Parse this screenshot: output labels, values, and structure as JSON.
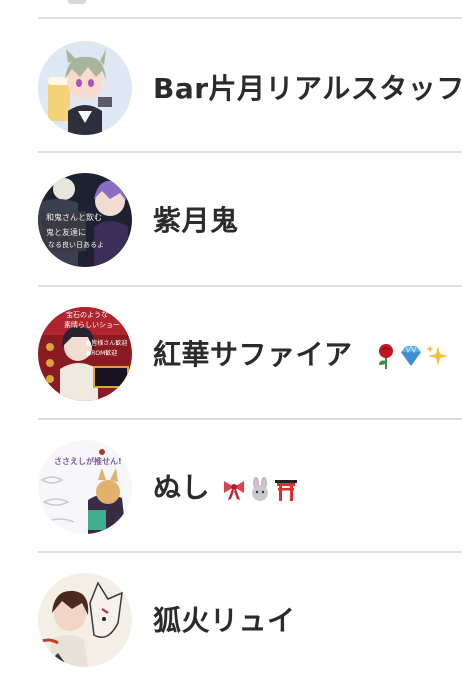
{
  "users": [
    {
      "name": "Bar片月リアルスタッフ",
      "avatar_icon": "avatar-bar-kataduki"
    },
    {
      "name": "紫月鬼",
      "avatar_icon": "avatar-shizuki"
    },
    {
      "name": "紅華サファイア",
      "avatar_icon": "avatar-kouka",
      "emojis": [
        "rose-emoji",
        "gem-emoji",
        "sparkles-emoji"
      ]
    },
    {
      "name": "ぬし",
      "avatar_icon": "avatar-nushi",
      "emojis": [
        "ribbon-emoji",
        "rabbit-emoji",
        "torii-emoji"
      ]
    },
    {
      "name": "狐火リュイ",
      "avatar_icon": "avatar-kitsunebi"
    }
  ],
  "avatar_texts": {
    "shizuki_line1": "和鬼さんと飲む",
    "shizuki_line2": "鬼と友達に",
    "shizuki_line3": "なる良い日あるよ",
    "kouka_line1": "宝石のような",
    "kouka_line2": "素晴らしいショー",
    "kouka_line3": "●皆様さん歓迎",
    "kouka_line4": "●ROM歓迎",
    "nushi_line1": "ささえしが推せん!"
  }
}
